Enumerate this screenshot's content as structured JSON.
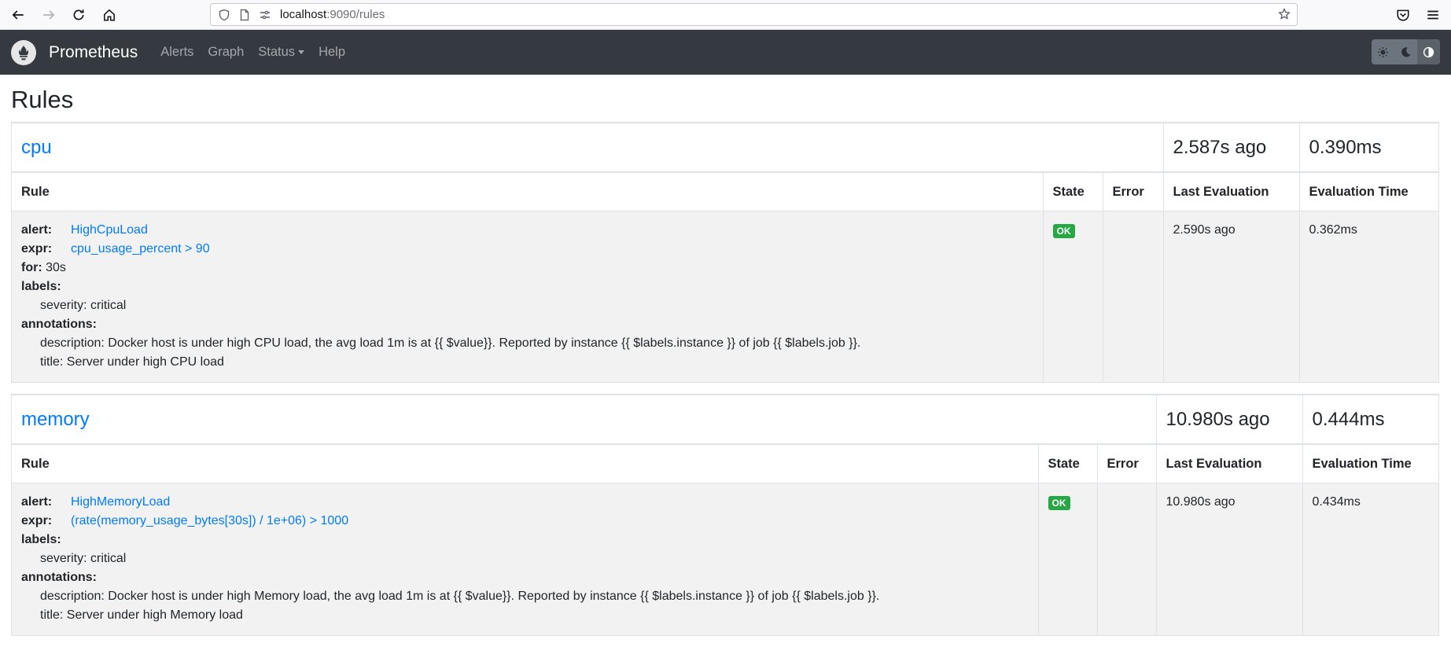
{
  "browser": {
    "url_host": "localhost",
    "url_rest": ":9090/rules"
  },
  "navbar": {
    "brand": "Prometheus",
    "links": [
      "Alerts",
      "Graph",
      "Status",
      "Help"
    ]
  },
  "page": {
    "title": "Rules"
  },
  "table_headers": {
    "rule": "Rule",
    "state": "State",
    "error": "Error",
    "last_evaluation": "Last Evaluation",
    "evaluation_time": "Evaluation Time"
  },
  "groups": [
    {
      "name": "cpu",
      "last_evaluation": "2.587s ago",
      "evaluation_time": "0.390ms",
      "rule": {
        "alert_key": "alert:",
        "alert": "HighCpuLoad",
        "expr_key": "expr:",
        "expr": "cpu_usage_percent > 90",
        "for_key": "for:",
        "for": "30s",
        "labels_key": "labels:",
        "label_severity": "severity: critical",
        "annotations_key": "annotations:",
        "description": "description: Docker host is under high CPU load, the avg load 1m is at {{ $value}}. Reported by instance {{ $labels.instance }} of job {{ $labels.job }}.",
        "title": "title: Server under high CPU load",
        "state": "OK",
        "error": "",
        "last_evaluation": "2.590s ago",
        "evaluation_time": "0.362ms"
      }
    },
    {
      "name": "memory",
      "last_evaluation": "10.980s ago",
      "evaluation_time": "0.444ms",
      "rule": {
        "alert_key": "alert:",
        "alert": "HighMemoryLoad",
        "expr_key": "expr:",
        "expr": "(rate(memory_usage_bytes[30s]) / 1e+06) > 1000",
        "labels_key": "labels:",
        "label_severity": "severity: critical",
        "annotations_key": "annotations:",
        "description": "description: Docker host is under high Memory load, the avg load 1m is at {{ $value}}. Reported by instance {{ $labels.instance }} of job {{ $labels.job }}.",
        "title": "title: Server under high Memory load",
        "state": "OK",
        "error": "",
        "last_evaluation": "10.980s ago",
        "evaluation_time": "0.434ms"
      }
    }
  ]
}
